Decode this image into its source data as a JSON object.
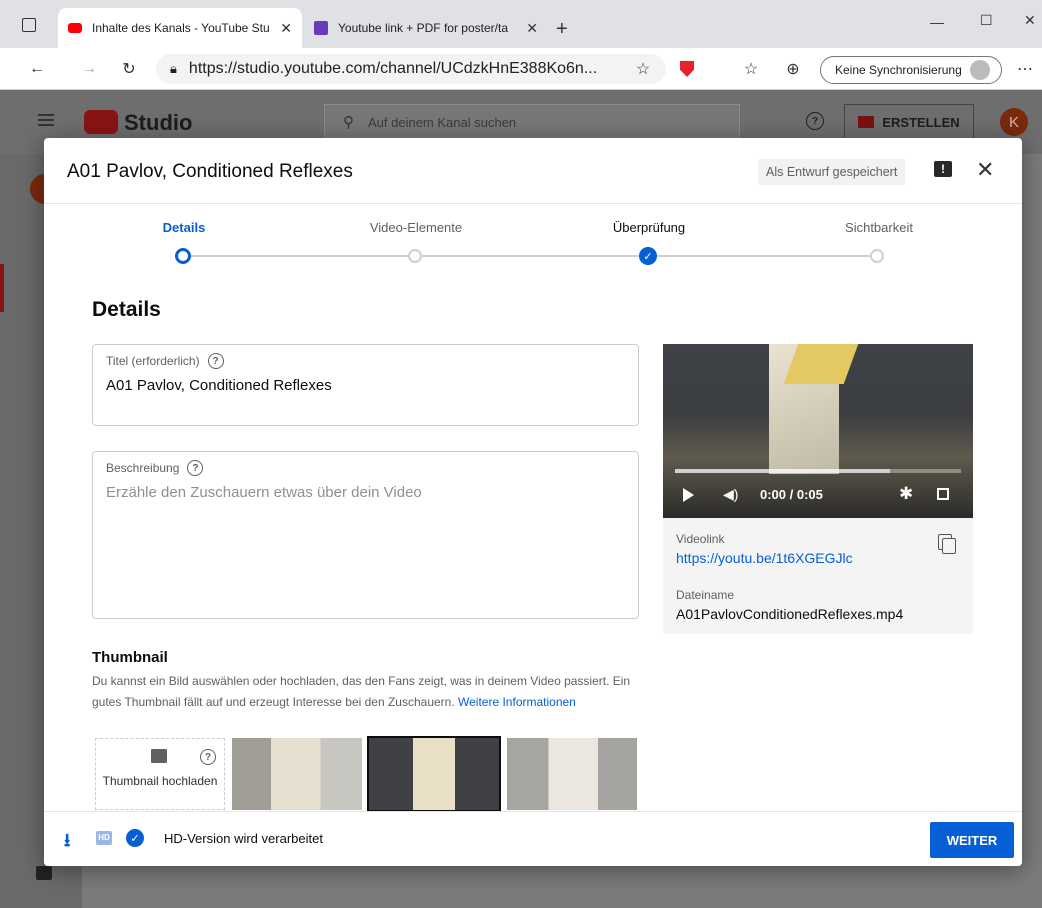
{
  "browser": {
    "tabs": [
      {
        "label": "Inhalte des Kanals - YouTube Stu",
        "close": "✕"
      },
      {
        "label": "Youtube link + PDF for poster/ta",
        "close": "✕"
      }
    ],
    "new_tab": "+",
    "url": "https://studio.youtube.com/channel/UCdzkHnE388Ko6n...",
    "sync_label": "Keine Synchronisierung",
    "window_controls": {
      "minimize": "—",
      "maximize": "☐",
      "close": "✕"
    }
  },
  "studio": {
    "logo": "Studio",
    "search_placeholder": "Auf deinem Kanal suchen",
    "create_label": "ERSTELLEN",
    "avatar_letter": "K"
  },
  "modal": {
    "title": "A01 Pavlov, Conditioned Reflexes",
    "draft_badge": "Als Entwurf gespeichert",
    "steps": [
      "Details",
      "Video-Elemente",
      "Überprüfung",
      "Sichtbarkeit"
    ],
    "section_title": "Details",
    "title_field": {
      "label": "Titel (erforderlich)",
      "value": "A01 Pavlov, Conditioned Reflexes"
    },
    "description_field": {
      "label": "Beschreibung",
      "placeholder": "Erzähle den Zuschauern etwas über dein Video"
    },
    "video": {
      "time": "0:00 / 0:05",
      "videolink_label": "Videolink",
      "videolink": "https://youtu.be/1t6XGEGJlc",
      "filename_label": "Dateiname",
      "filename": "A01PavlovConditionedReflexes.mp4",
      "progress": 0.75
    },
    "thumbnail": {
      "heading": "Thumbnail",
      "text": "Du kannst ein Bild auswählen oder hochladen, das den Fans zeigt, was in deinem Video passiert. Ein gutes Thumbnail fällt auf und erzeugt Interesse bei den Zuschauern.",
      "link": "Weitere Informationen",
      "upload_label": "Thumbnail hochladen"
    },
    "footer": {
      "status": "HD-Version wird verarbeitet",
      "hd_badge": "HD",
      "next": "WEITER"
    }
  },
  "colors": {
    "accent": "#065fd4",
    "youtube_red": "#ff0000",
    "step_done": "#065fd4"
  }
}
